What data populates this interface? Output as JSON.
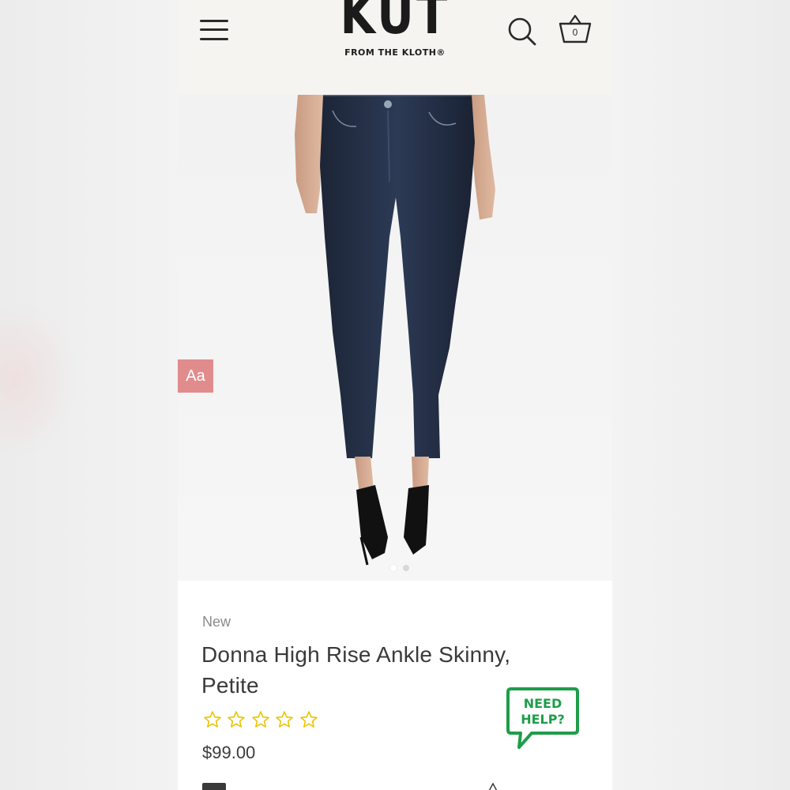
{
  "header": {
    "logo_main": "KUT",
    "logo_sub": "FROM THE KLOTH®",
    "cart_count": "0"
  },
  "accessibility": {
    "label": "Aa"
  },
  "gallery": {
    "active_index": 0,
    "total": 2
  },
  "product": {
    "badge": "New",
    "title": "Donna High Rise Ankle Skinny, Petite",
    "rating": {
      "filled": 0,
      "total": 5,
      "star_color": "#e9c400"
    },
    "price": "$99.00"
  },
  "help_button": {
    "line1": "NEED",
    "line2": "HELP?",
    "color": "#1f9d4a"
  }
}
